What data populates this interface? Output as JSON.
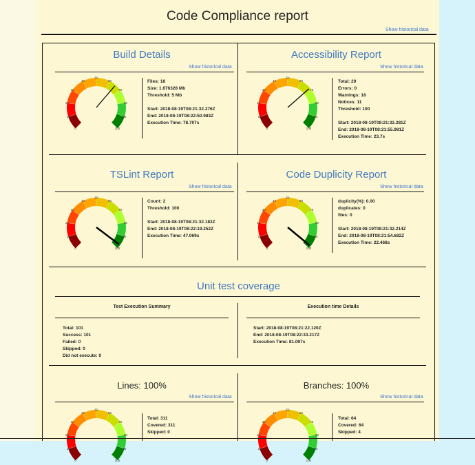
{
  "page": {
    "title": "Code Compliance report",
    "history_link": "Show historical data"
  },
  "build": {
    "title": "Build Details",
    "link": "Show historical data",
    "stats": [
      "Files: 18",
      "Size: 1.676328 Mb",
      "Threshold: 5 Mb",
      "",
      "Start: 2018-08-19T08:21:32.276Z",
      "End: 2018-08-19T08:22:50.983Z",
      "Execution Time: 78.707s"
    ],
    "gauge_value": 65
  },
  "accessibility": {
    "title": "Accessibility Report",
    "link": "Show historical data",
    "stats": [
      "Total: 29",
      "Errors: 0",
      "Warnings: 18",
      "Notices: 11",
      "Threshold: 100",
      "",
      "Start: 2018-08-19T08:21:32.281Z",
      "End: 2018-08-19T08:21:55.981Z",
      "Execution Time: 23.7s"
    ],
    "gauge_value": 68
  },
  "tslint": {
    "title": "TSLint Report",
    "link": "Show historical data",
    "stats": [
      "Count: 2",
      "Threshold: 100",
      "",
      "Start: 2018-08-19T08:21:32.183Z",
      "End: 2018-08-19T08:22:19.252Z",
      "Execution Time: 47.069s"
    ],
    "gauge_value": 97
  },
  "duplicity": {
    "title": "Code Duplicity Report",
    "link": "Show historical data",
    "stats": [
      "duplicity(%): 0.00",
      "duplicates: 0",
      "files: 0",
      "",
      "Start: 2018-08-19T08:21:32.214Z",
      "End: 2018-08-19T08:21:54.682Z",
      "Execution Time: 22.468s"
    ],
    "gauge_value": 98
  },
  "unit": {
    "title": "Unit test coverage",
    "summary_head": "Test Execution Summary",
    "details_head": "Execution time Details",
    "summary": [
      "Total: 101",
      "Success: 101",
      "Failed: 0",
      "Skipped: 0",
      "Did not execute: 0"
    ],
    "details": [
      "Start: 2018-08-19T08:21:22.120Z",
      "End: 2018-08-19T08:22:33.217Z",
      "Execution Time: 81.097s"
    ]
  },
  "lines": {
    "title": "Lines: 100%",
    "link": "Show historical data",
    "stats": [
      "Total: 311",
      "Covered: 311",
      "Skipped: 0"
    ]
  },
  "branches": {
    "title": "Branches: 100%",
    "link": "Show historical data",
    "stats": [
      "Total: 64",
      "Covered: 64",
      "Skipped: 4"
    ]
  },
  "gauge": {
    "ticks": [
      "0",
      "10",
      "20",
      "30",
      "40",
      "50",
      "60",
      "70",
      "80",
      "90",
      "100"
    ],
    "colors": [
      "#8b0000",
      "#ff0000",
      "#ff4500",
      "#ff8c00",
      "#ffa500",
      "#f0c000",
      "#ccdd00",
      "#adff2f",
      "#32cd32",
      "#008000"
    ]
  }
}
